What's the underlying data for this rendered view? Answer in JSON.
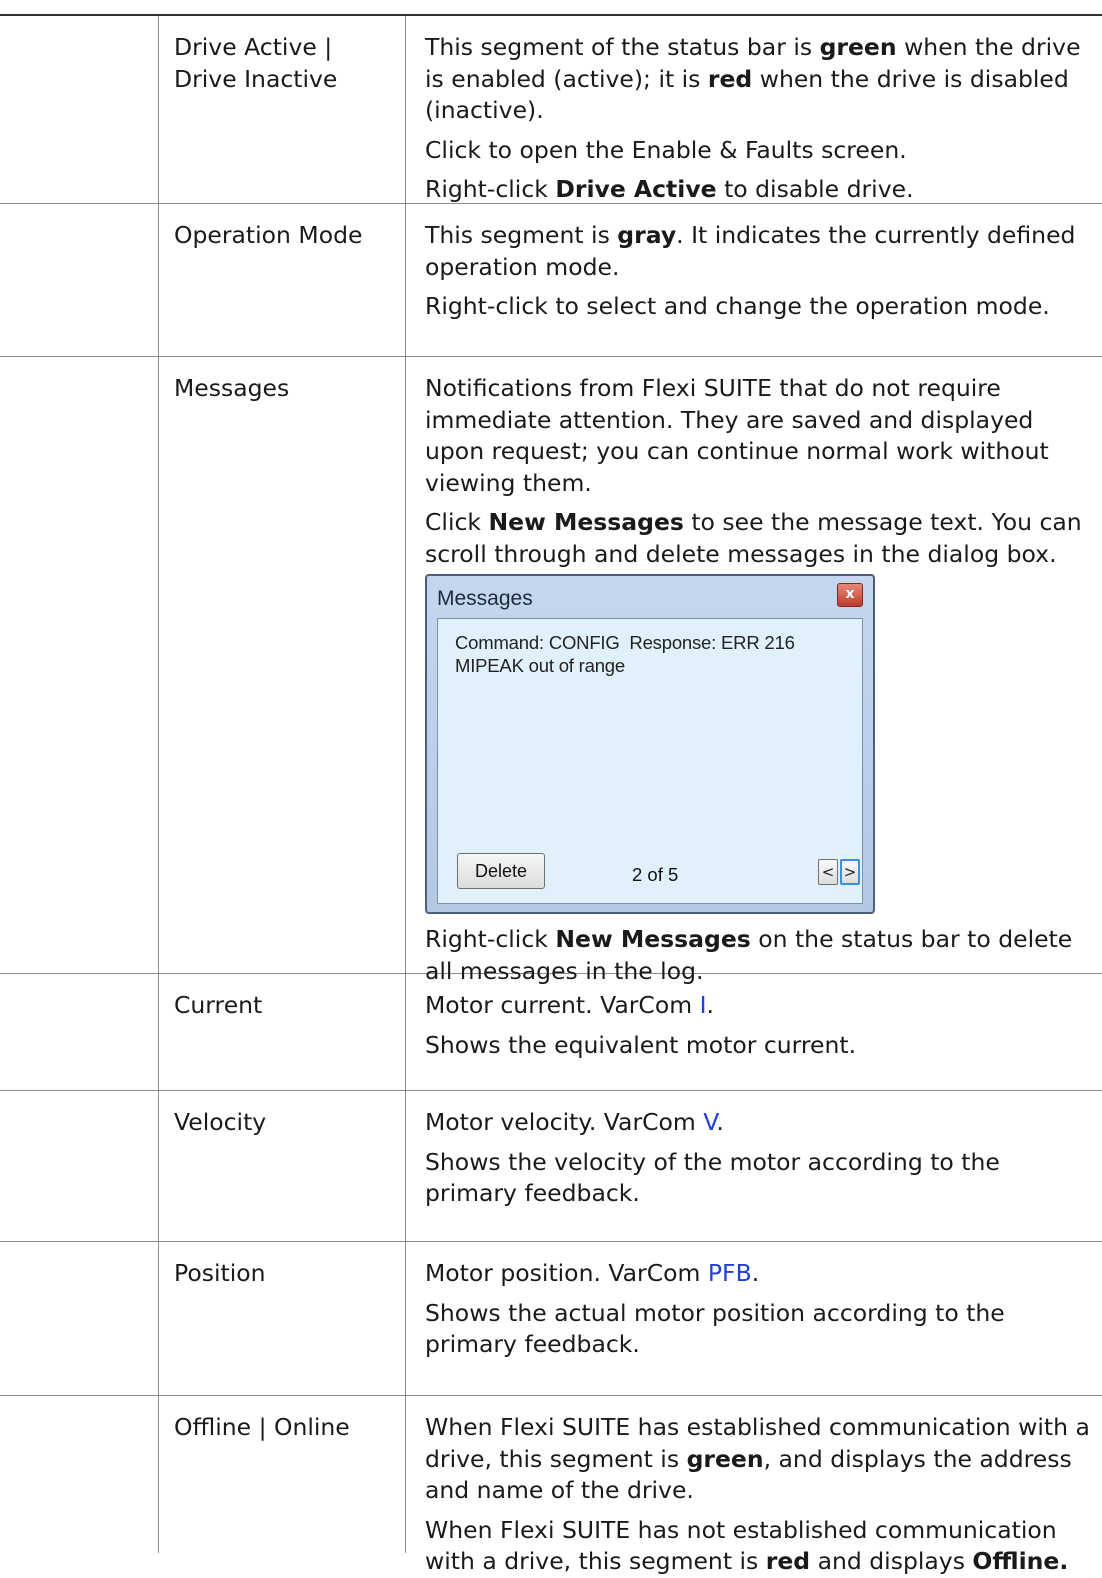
{
  "rows": [
    {
      "item": "Drive Active | Drive Inactive",
      "p1": {
        "t1": "This segment of the status bar is ",
        "b1": "green",
        "t2": " when the drive is enabled (active); it is ",
        "b2": "red",
        "t3": " when the drive is disabled (inactive)."
      },
      "p2": "Click to open the Enable & Faults screen.",
      "p3": {
        "t1": "Right-click ",
        "b1": "Drive Active",
        "t2": " to disable drive."
      }
    },
    {
      "item": "Operation Mode",
      "p1": {
        "t1": "This segment is ",
        "b1": "gray",
        "t2": ". It indicates the currently defined operation mode."
      },
      "p2": "Right-click to select and change the operation mode."
    },
    {
      "item": "Messages",
      "p1": "Notifications from Flexi SUITE that do not require immediate attention. They are saved and displayed upon request; you can continue normal work without viewing them.",
      "p2": {
        "t1": "Click ",
        "b1": "New Messages",
        "t2": " to see the message text. You can scroll through and delete messages in the dialog box."
      },
      "dialog": {
        "title": "Messages",
        "close": "x",
        "message_line1": "Command: CONFIG  Response: ERR 216",
        "message_line2": "MIPEAK out of range",
        "delete_label": "Delete",
        "counter": "2 of 5",
        "prev": "<",
        "next": ">"
      },
      "p3": {
        "t1": "Right-click ",
        "b1": "New Messages",
        "t2": " on the status bar to delete all messages in the log."
      }
    },
    {
      "item": "Current",
      "p1": {
        "t1": "Motor current. VarCom ",
        "vc": "I",
        "t2": "."
      },
      "p2": "Shows the equivalent motor current."
    },
    {
      "item": "Velocity",
      "p1": {
        "t1": "Motor velocity. VarCom ",
        "vc": "V",
        "t2": "."
      },
      "p2": "Shows the velocity of the motor according to the primary feedback."
    },
    {
      "item": "Position",
      "p1": {
        "t1": "Motor position. VarCom ",
        "vc": "PFB",
        "t2": "."
      },
      "p2": "Shows the actual motor position according to the primary feedback."
    },
    {
      "item": "Offline | Online",
      "p1": {
        "t1": "When Flexi SUITE has established communication with a drive, this segment is ",
        "b1": "green",
        "t2": ", and displays the address and name of the drive."
      },
      "p2": {
        "t1": "When Flexi SUITE has not established communication with a drive, this segment is ",
        "b1": "red",
        "t2": " and displays ",
        "b2": "Offline."
      }
    }
  ]
}
